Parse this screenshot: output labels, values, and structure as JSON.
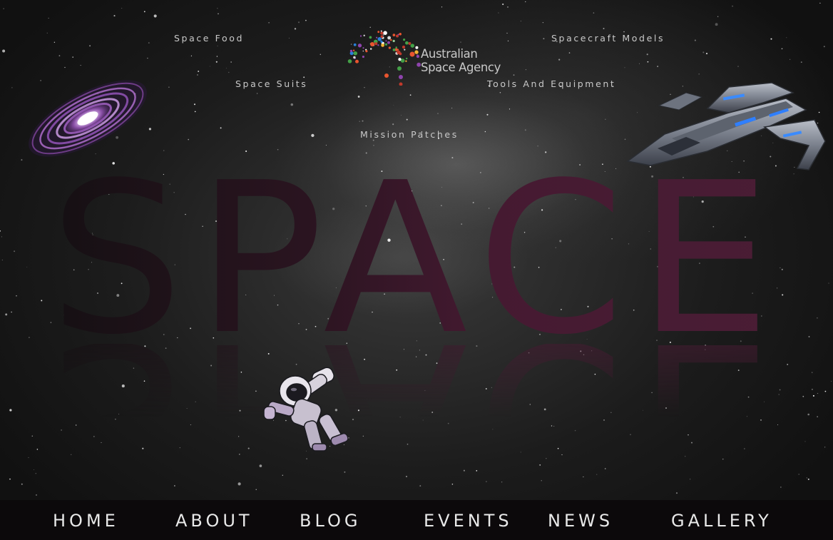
{
  "header": {
    "links": [
      {
        "label": "Space Food"
      },
      {
        "label": "Space Suits"
      },
      {
        "label": "Mission Patches"
      },
      {
        "label": "Tools And Equipment"
      },
      {
        "label": "Spacecraft Models"
      }
    ],
    "logo": {
      "line1": "Australian",
      "line2": "Space Agency"
    }
  },
  "hero": {
    "word": "SPACE",
    "color": "#4a1d33"
  },
  "images": {
    "galaxy": "galaxy-image",
    "spaceship": "spaceship-image",
    "astronaut": "astronaut-image"
  },
  "nav": {
    "items": [
      {
        "label": "HOME"
      },
      {
        "label": "ABOUT"
      },
      {
        "label": "BLOG"
      },
      {
        "label": "EVENTS"
      },
      {
        "label": "NEWS"
      },
      {
        "label": "GALLERY"
      }
    ]
  }
}
